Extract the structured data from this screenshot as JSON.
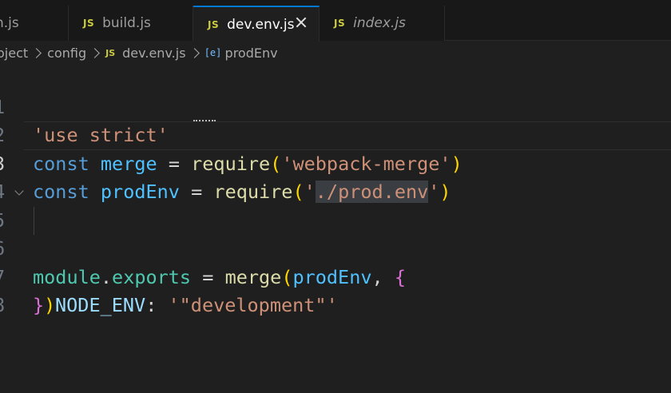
{
  "tabs": [
    {
      "label": "n.js",
      "active": false,
      "italic": false,
      "icon": "js-file-icon"
    },
    {
      "label": "build.js",
      "active": false,
      "italic": false,
      "icon": "js-file-icon"
    },
    {
      "label": "dev.env.js",
      "active": true,
      "italic": false,
      "icon": "js-file-icon"
    },
    {
      "label": "index.js",
      "active": false,
      "italic": true,
      "icon": "js-file-icon"
    }
  ],
  "js_badge": "JS",
  "breadcrumb": {
    "root": "oject",
    "folder": "config",
    "file": "dev.env.js",
    "symbol": "prodEnv",
    "symbol_icon": "variable-icon"
  },
  "editor": {
    "line_numbers": [
      "1",
      "2",
      "3",
      "4",
      "5",
      "6",
      "7",
      "8"
    ],
    "current_line": 3,
    "lines": {
      "l1": {
        "str": "'use strict'"
      },
      "l2": {
        "kw": "const",
        "name": "merge",
        "eq": "=",
        "fn": "require",
        "lp": "(",
        "str": "'webpack-merge'",
        "rp": ")"
      },
      "l3": {
        "kw": "const",
        "name": "prodEnv",
        "eq": "=",
        "fn": "require",
        "lp": "(",
        "q1": "'",
        "path": "./prod.env",
        "q2": "'",
        "rp": ")"
      },
      "l5": {
        "obj": "module",
        "dot": ".",
        "prop": "exports",
        "eq": "=",
        "fn": "merge",
        "lp": "(",
        "arg": "prodEnv",
        "comma": ",",
        "brace": "{"
      },
      "l6": {
        "key": "NODE_ENV",
        "colon": ":",
        "str": "'\"development\"'"
      },
      "l7": {
        "brace": "}",
        "rp": ")"
      }
    }
  },
  "colors": {
    "accent": "#0078d4",
    "js_badge": "#cbcb41",
    "string": "#ce9178",
    "keyword": "#569cd6",
    "function": "#dcdcaa"
  }
}
